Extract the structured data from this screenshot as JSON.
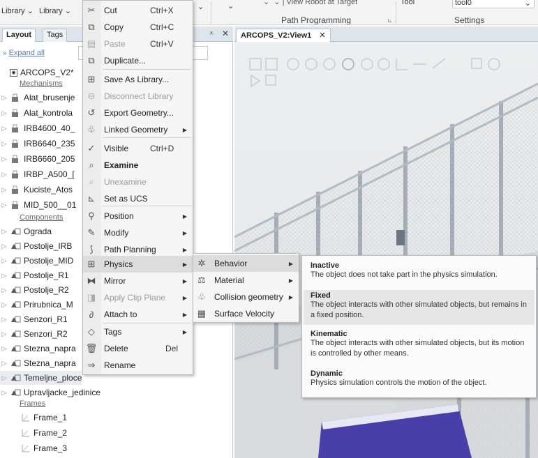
{
  "ribbon": {
    "library1": "Library",
    "library2": "Library",
    "view_robot_target": "View Robot at Target",
    "tool_label": "Tool",
    "tool_value": "tool0",
    "group_path_programming": "Path Programming",
    "group_settings": "Settings"
  },
  "left_panel": {
    "tabs": [
      {
        "label": "Layout"
      },
      {
        "label": "Tags"
      }
    ],
    "expand_all": "Expand all",
    "root": "ARCOPS_V2*",
    "groups": {
      "mechanisms": "Mechanisms",
      "components": "Components",
      "frames": "Frames"
    },
    "mechanisms": [
      "Alat_brusenje",
      "Alat_kontrola",
      "IRB4600_40_",
      "IRB6640_235",
      "IRB6660_205",
      "IRBP_A500_[",
      "Kuciste_Atos",
      "MID_500__01"
    ],
    "components": [
      "Ograda",
      "Postolje_IRB",
      "Postolje_MID",
      "Postolje_R1",
      "Postolje_R2",
      "Prirubnica_M",
      "Senzori_R1",
      "Senzori_R2",
      "Stezna_napra",
      "Stezna_napra",
      "Temeljne_ploce",
      "Upravljacke_jedinice"
    ],
    "frames": [
      "Frame_1",
      "Frame_2",
      "Frame_3"
    ]
  },
  "viewport": {
    "tab_label": "ARCOPS_V2:View1"
  },
  "context_menu": {
    "items": [
      {
        "label": "Cut",
        "shortcut": "Ctrl+X",
        "icon": "scissors-icon"
      },
      {
        "label": "Copy",
        "shortcut": "Ctrl+C",
        "icon": "copy-icon"
      },
      {
        "label": "Paste",
        "shortcut": "Ctrl+V",
        "icon": "paste-icon"
      },
      {
        "label": "Duplicate...",
        "shortcut": "",
        "icon": "duplicate-icon"
      },
      {
        "label": "Save As Library...",
        "shortcut": "",
        "icon": "save-library-icon"
      },
      {
        "label": "Disconnect Library",
        "shortcut": "",
        "icon": "disconnect-icon"
      },
      {
        "label": "Export Geometry...",
        "shortcut": "",
        "icon": "export-icon"
      },
      {
        "label": "Linked Geometry",
        "shortcut": "",
        "icon": "linked-geometry-icon"
      },
      {
        "label": "Visible",
        "shortcut": "Ctrl+D",
        "icon": "checkmark-icon"
      },
      {
        "label": "Examine",
        "shortcut": "",
        "icon": "examine-icon"
      },
      {
        "label": "Unexamine",
        "shortcut": "",
        "icon": "unexamine-icon"
      },
      {
        "label": "Set as UCS",
        "shortcut": "",
        "icon": "ucs-icon"
      },
      {
        "label": "Position",
        "shortcut": "",
        "icon": "position-icon"
      },
      {
        "label": "Modify",
        "shortcut": "",
        "icon": "modify-icon"
      },
      {
        "label": "Path Planning",
        "shortcut": "",
        "icon": "path-planning-icon"
      },
      {
        "label": "Physics",
        "shortcut": "",
        "icon": "physics-icon"
      },
      {
        "label": "Mirror",
        "shortcut": "",
        "icon": "mirror-icon"
      },
      {
        "label": "Apply Clip Plane",
        "shortcut": "",
        "icon": "clip-plane-icon"
      },
      {
        "label": "Attach to",
        "shortcut": "",
        "icon": "attach-icon"
      },
      {
        "label": "Tags",
        "shortcut": "",
        "icon": "tag-icon"
      },
      {
        "label": "Delete",
        "shortcut": "Del",
        "icon": "delete-icon"
      },
      {
        "label": "Rename",
        "shortcut": "",
        "icon": "rename-icon"
      }
    ]
  },
  "physics_menu": {
    "items": [
      {
        "label": "Behavior"
      },
      {
        "label": "Material"
      },
      {
        "label": "Collision geometry"
      },
      {
        "label": "Surface Velocity"
      }
    ]
  },
  "behavior_menu": {
    "items": [
      {
        "title": "Inactive",
        "desc": "The object does not take part in the physics simulation."
      },
      {
        "title": "Fixed",
        "desc": "The object interacts with other simulated objects, but remains in a fixed position."
      },
      {
        "title": "Kinematic",
        "desc": "The object interacts with other simulated objects, but its motion is controlled by other means."
      },
      {
        "title": "Dynamic",
        "desc": "Physics simulation controls the motion of the object."
      }
    ]
  }
}
